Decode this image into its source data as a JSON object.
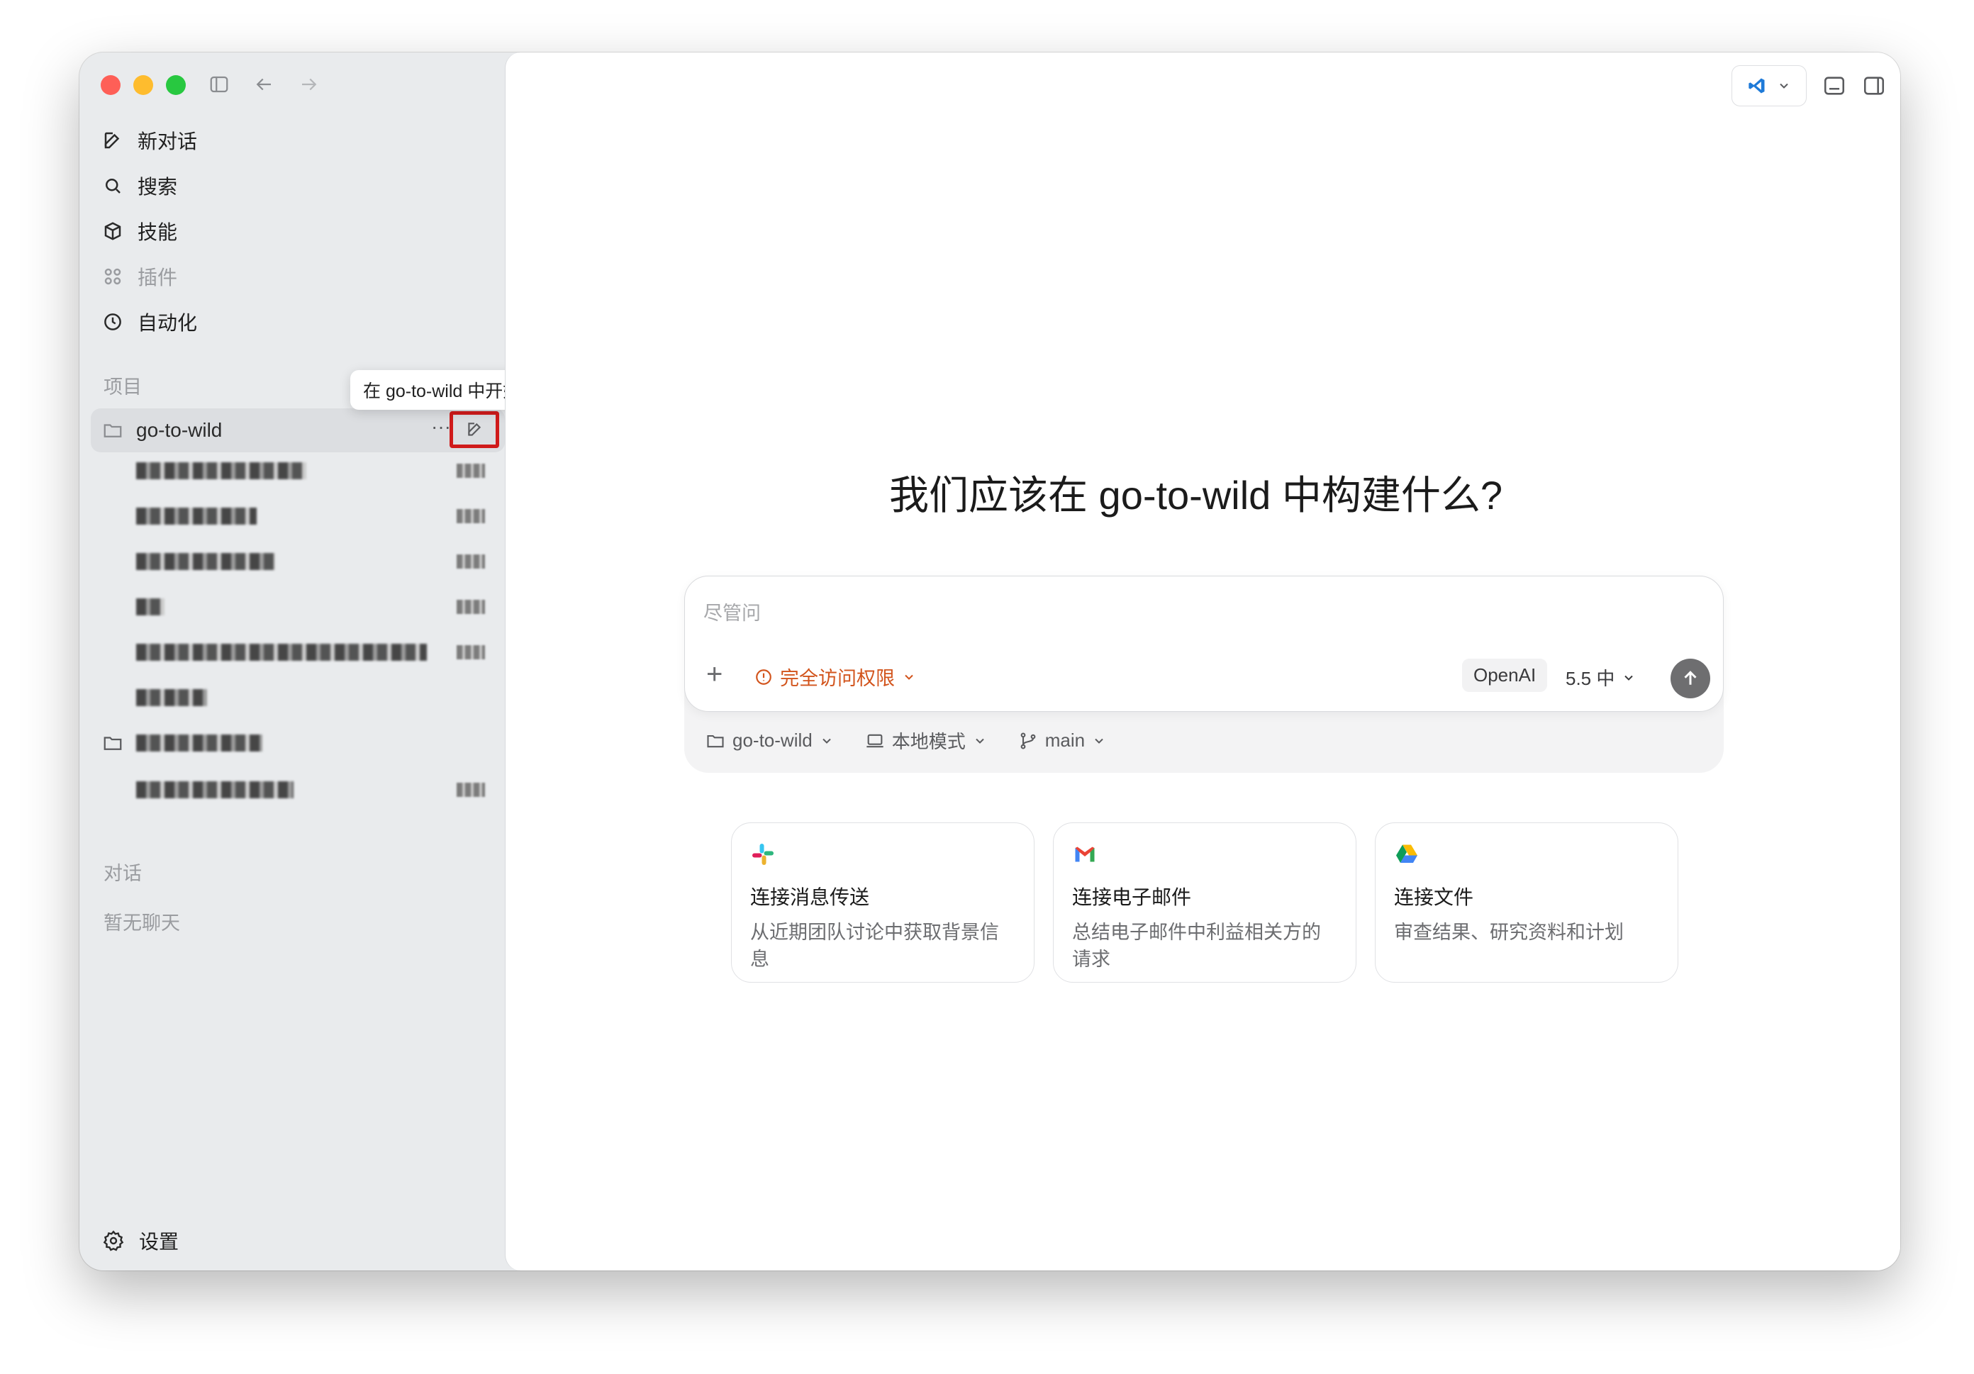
{
  "sidebar": {
    "nav": [
      {
        "label": "新对话",
        "icon": "new-chat-icon"
      },
      {
        "label": "搜索",
        "icon": "search-icon"
      },
      {
        "label": "技能",
        "icon": "skills-icon"
      },
      {
        "label": "插件",
        "icon": "plugins-icon"
      },
      {
        "label": "自动化",
        "icon": "clock-icon"
      }
    ],
    "projects_label": "项目",
    "project_name": "go-to-wild",
    "tooltip": "在 go-to-wild 中开始新对话",
    "chats_label": "对话",
    "chats_empty": "暂无聊天",
    "settings_label": "设置"
  },
  "main": {
    "headline": "我们应该在 go-to-wild 中构建什么?",
    "composer": {
      "placeholder": "尽管问",
      "access_label": "完全访问权限",
      "provider": "OpenAI",
      "model_version": "5.5 中"
    },
    "context_row": {
      "project": "go-to-wild",
      "mode": "本地模式",
      "branch": "main"
    },
    "cards": [
      {
        "title": "连接消息传送",
        "desc": "从近期团队讨论中获取背景信息",
        "icon": "slack-icon"
      },
      {
        "title": "连接电子邮件",
        "desc": "总结电子邮件中利益相关方的请求",
        "icon": "gmail-icon"
      },
      {
        "title": "连接文件",
        "desc": "审查结果、研究资料和计划",
        "icon": "drive-icon"
      }
    ]
  },
  "colors": {
    "accent_warning": "#d2541c",
    "highlight": "#d01a1a"
  }
}
